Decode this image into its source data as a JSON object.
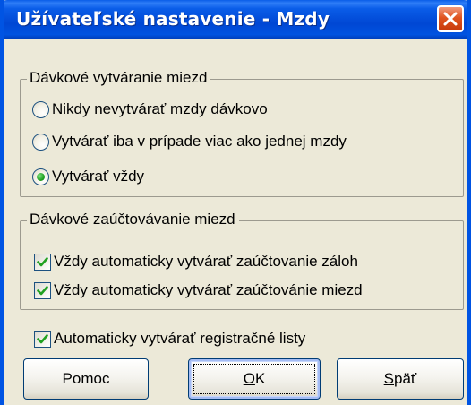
{
  "window": {
    "title": "Užívateľské nastavenie - Mzdy",
    "colors": {
      "titlebar": "#0054e3",
      "close": "#e0541f",
      "dialog_bg": "#ece9d8"
    }
  },
  "group_batch_create": {
    "legend": "Dávkové vytváranie miezd",
    "options": [
      {
        "label": "Nikdy nevytvárať mzdy dávkovo",
        "checked": false
      },
      {
        "label": "Vytvárať iba v prípade viac ako jednej mzdy",
        "checked": false
      },
      {
        "label": "Vytvárať vždy",
        "checked": true
      }
    ]
  },
  "group_batch_posting": {
    "legend": "Dávkové zaúčtovávanie miezd",
    "options": [
      {
        "label": "Vždy automaticky vytvárať zaúčtovanie záloh",
        "checked": true
      },
      {
        "label": "Vždy automaticky vytvárať zaúčtovánie miezd",
        "checked": true
      }
    ]
  },
  "registration_lists": {
    "label": "Automaticky vytvárať registračné listy",
    "checked": true
  },
  "buttons": {
    "help": "Pomoc",
    "ok_mnemonic": "O",
    "ok_rest": "K",
    "back_mnemonic": "S",
    "back_rest": "päť"
  }
}
